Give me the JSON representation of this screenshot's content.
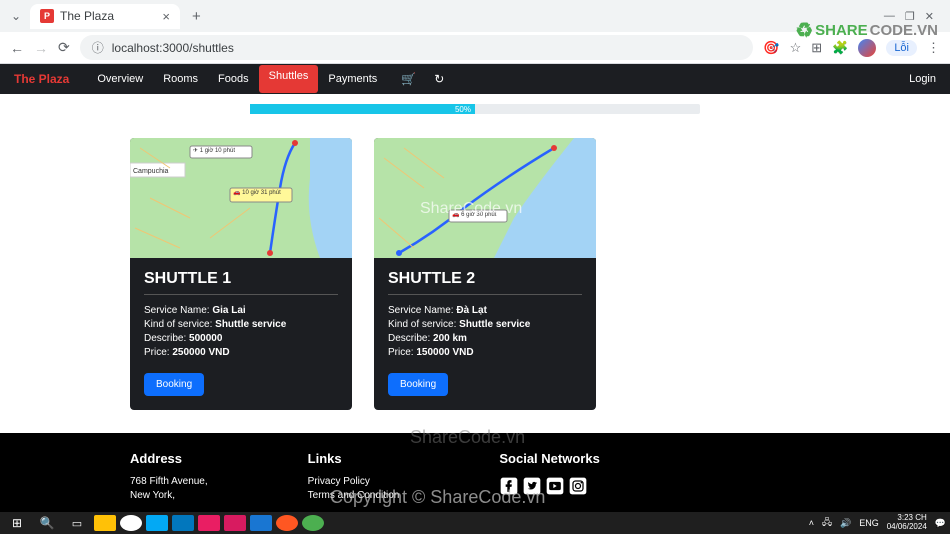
{
  "browser": {
    "tab_title": "The Plaza",
    "tab_favicon_letter": "P",
    "url": "localhost:3000/shuttles",
    "ext_label": "Lỗi"
  },
  "watermark_logo": {
    "part1": "SHARE",
    "part2": "CODE.VN"
  },
  "navbar": {
    "brand": "The Plaza",
    "links": [
      "Overview",
      "Rooms",
      "Foods",
      "Shuttles",
      "Payments"
    ],
    "active_index": 3,
    "login": "Login"
  },
  "progress": {
    "percent": 50,
    "label": "50%"
  },
  "shuttles": [
    {
      "title": "SHUTTLE 1",
      "service_name_label": "Service Name:",
      "service_name": "Gia Lai",
      "kind_label": "Kind of service:",
      "kind": "Shuttle service",
      "describe_label": "Describe:",
      "describe": "500000",
      "price_label": "Price:",
      "price": "250000 VND",
      "button": "Booking",
      "map_label1": "✈ 1 giờ 10 phút",
      "map_label2": "🚗 10 giờ 31 phút"
    },
    {
      "title": "SHUTTLE 2",
      "service_name_label": "Service Name:",
      "service_name": "Đà Lạt",
      "kind_label": "Kind of service:",
      "kind": "Shuttle service",
      "describe_label": "Describe:",
      "describe": "200 km",
      "price_label": "Price:",
      "price": "150000 VND",
      "button": "Booking",
      "map_label1": "🚗 6 giờ 30 phút",
      "map_label2": ""
    }
  ],
  "footer": {
    "address_title": "Address",
    "address_line1": "768 Fifth Avenue,",
    "address_line2": "New York,",
    "links_title": "Links",
    "link1": "Privacy Policy",
    "link2": "Terms and Condition",
    "social_title": "Social Networks"
  },
  "watermarks": {
    "wm1": "ShareCode.vn",
    "wm2": "ShareCode.vn",
    "wm3": "Copyright © ShareCode.vn"
  },
  "taskbar": {
    "lang": "ENG",
    "time": "3:23 CH",
    "date": "04/06/2024"
  }
}
